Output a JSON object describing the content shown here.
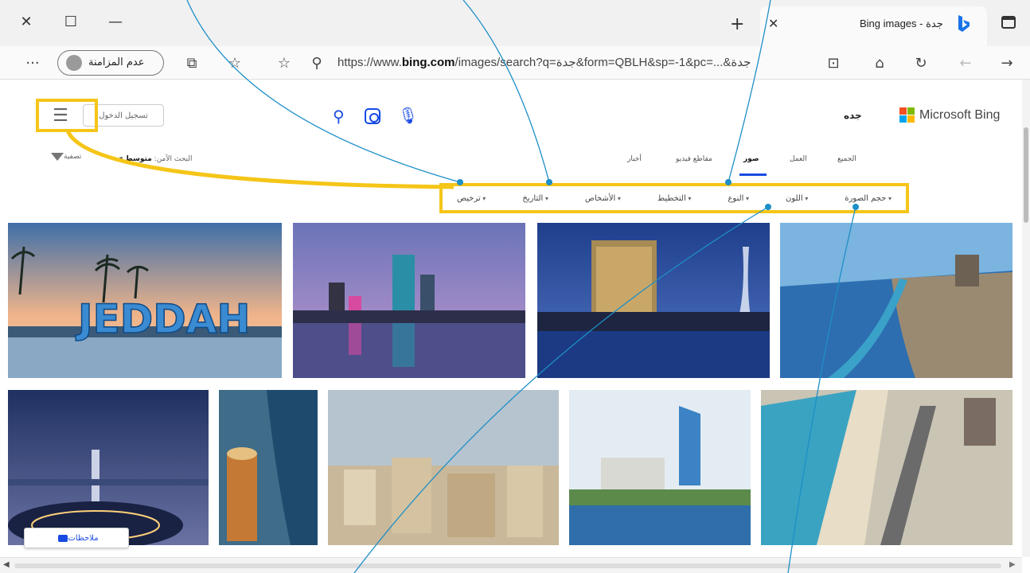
{
  "browser": {
    "tab_title": "Bing images - جدة",
    "url_prefix": "https://www.",
    "url_domain": "bing.com",
    "url_rest": "/images/search?q=جدة&form=QBLH&sp=-1&pc=...&جدة",
    "profile_label": "عدم المزامنة",
    "icons": [
      "close-icon",
      "restore-icon",
      "minimize-icon",
      "new-tab-icon",
      "tab-actions-icon",
      "more-icon",
      "collections-icon",
      "favorites-icon",
      "add-favorite-icon",
      "zoom-icon",
      "app-available-icon",
      "home-icon",
      "refresh-icon",
      "back-icon",
      "forward-icon"
    ]
  },
  "header": {
    "brand": "Microsoft Bing",
    "query": "جده",
    "signin_label": "تسجيل الدخول"
  },
  "scopes": [
    {
      "label": "الجميع"
    },
    {
      "label": "العمل"
    },
    {
      "label": "صور"
    },
    {
      "label": "مقاطع فيديو"
    },
    {
      "label": "أخبار"
    }
  ],
  "safesearch": {
    "label": "البحث الآمن:",
    "value": "متوسط"
  },
  "filter_label": "تصفية",
  "filters": [
    {
      "label": "حجم الصورة"
    },
    {
      "label": "اللون"
    },
    {
      "label": "النوع"
    },
    {
      "label": "التخطيط"
    },
    {
      "label": "الأشخاص"
    },
    {
      "label": "التاريخ"
    },
    {
      "label": "ترخيص"
    }
  ],
  "images": [
    {
      "caption": "JEDDAH"
    }
  ],
  "feedback_label": "ملاحظات",
  "colors": {
    "accent": "#174ae4",
    "highlight": "#f5c518",
    "callout": "#1e8fc7",
    "ms_red": "#f25022",
    "ms_green": "#7fba00",
    "ms_blue": "#00a4ef",
    "ms_yellow": "#ffb900"
  }
}
